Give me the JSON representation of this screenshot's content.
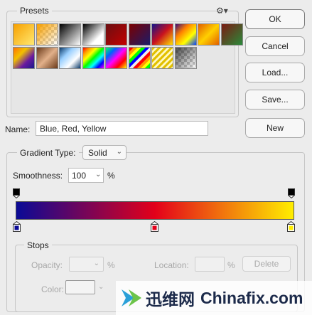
{
  "presets": {
    "title": "Presets",
    "gear_icon": "gear-icon",
    "swatches": [
      {
        "bg": "linear-gradient(135deg,#f7a000,#ffe870)"
      },
      {
        "bg": "linear-gradient(135deg,#f7a000 0%,rgba(247,160,0,0) 100%),repeating-conic-gradient(#ccc 0 25%,#fff 0 50%) 0 0/8px 8px"
      },
      {
        "bg": "linear-gradient(135deg,#000,#fff)"
      },
      {
        "bg": "linear-gradient(135deg,#000,#fff 70%)"
      },
      {
        "bg": "linear-gradient(135deg,#6a0f12,#c40000)"
      },
      {
        "bg": "linear-gradient(135deg,#7a0000,#1c1c6a)"
      },
      {
        "bg": "linear-gradient(135deg,#14148a,#c8121f,#ffe000)"
      },
      {
        "bg": "linear-gradient(135deg,#3c0a7a,#ff8000,#ffff00,#0040ff)"
      },
      {
        "bg": "linear-gradient(135deg,#e26000,#ffd000,#e26000)"
      },
      {
        "bg": "linear-gradient(135deg,#7a1a12,#2a8a3a)"
      },
      {
        "bg": "linear-gradient(135deg,#ff7000,#f2c000,#6a1aa0,#1a1a8a)"
      },
      {
        "bg": "linear-gradient(135deg,#6a3a1a,#e2b08a,#6a3a1a)"
      },
      {
        "bg": "linear-gradient(135deg,#0a3a6a,#9ad0ff,#fff,#0a3a6a)"
      },
      {
        "bg": "linear-gradient(135deg,#ff0000,#ff9900,#ffff00,#00ff00,#00ffff,#0000ff,#ff00ff)"
      },
      {
        "bg": "linear-gradient(135deg,#00ff60,#0060ff,#ff00ff,#ff0000,#ffff00)"
      },
      {
        "bg": "repeating-linear-gradient(135deg,#ff0000 0 4px,#ff9900 4px 8px,#ffff00 8px 12px,#00ff00 12px 16px,#0000ff 16px 20px,rgba(255,255,255,0.2) 20px 24px)"
      },
      {
        "bg": "repeating-linear-gradient(135deg,#e2c000 0 3px,#fff8c0 3px 6px),repeating-conic-gradient(#ccc 0 25%,#fff 0 50%) 0 0/8px 8px"
      },
      {
        "bg": "linear-gradient(135deg,rgba(0,0,0,0.7),rgba(0,0,0,0)),repeating-conic-gradient(#ccc 0 25%,#fff 0 50%) 0 0/8px 8px"
      }
    ]
  },
  "buttons": {
    "ok": "OK",
    "cancel": "Cancel",
    "load": "Load...",
    "save": "Save...",
    "new": "New"
  },
  "name": {
    "label": "Name:",
    "value": "Blue, Red, Yellow"
  },
  "gradient": {
    "type_label": "Gradient Type:",
    "type_value": "Solid",
    "smoothness_label": "Smoothness:",
    "smoothness_value": "100",
    "smoothness_unit": "%",
    "colors": {
      "start": "#0a0a96",
      "mid": "#e3001a",
      "end": "#ffee00"
    }
  },
  "stops": {
    "title": "Stops",
    "opacity_label": "Opacity:",
    "opacity_unit": "%",
    "location_label": "Location:",
    "location_unit": "%",
    "delete_label": "Delete",
    "color_label": "Color:"
  },
  "watermark": {
    "cn": "迅维网",
    "en": "Chinafix.com"
  }
}
